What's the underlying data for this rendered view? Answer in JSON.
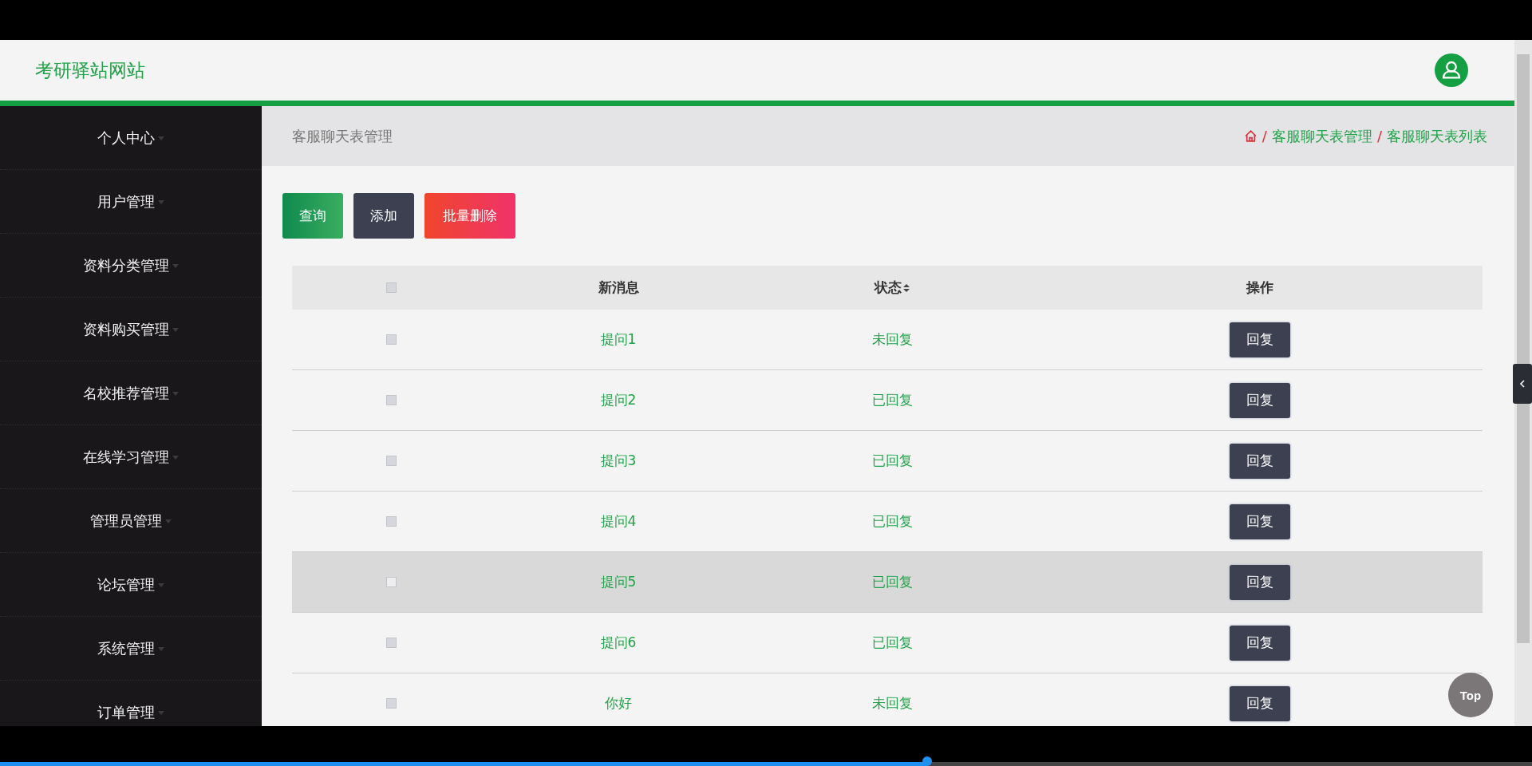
{
  "header": {
    "site_title": "考研驿站网站"
  },
  "sidebar": {
    "items": [
      {
        "label": "个人中心"
      },
      {
        "label": "用户管理"
      },
      {
        "label": "资料分类管理"
      },
      {
        "label": "资料购买管理"
      },
      {
        "label": "名校推荐管理"
      },
      {
        "label": "在线学习管理"
      },
      {
        "label": "管理员管理"
      },
      {
        "label": "论坛管理"
      },
      {
        "label": "系统管理"
      },
      {
        "label": "订单管理"
      }
    ]
  },
  "page_title": "客服聊天表管理",
  "breadcrumb": [
    {
      "separator": "/",
      "label": "客服聊天表管理"
    },
    {
      "separator": "/",
      "label": "客服聊天表列表"
    }
  ],
  "toolbar": [
    {
      "label": "查询",
      "kind": "search"
    },
    {
      "label": "添加",
      "kind": "add"
    },
    {
      "label": "批量删除",
      "kind": "delete"
    }
  ],
  "table": {
    "columns": [
      {
        "label": "新消息",
        "sortable": false
      },
      {
        "label": "状态",
        "sortable": true
      },
      {
        "label": "操作",
        "sortable": false
      }
    ],
    "header_checked": false,
    "rows": [
      {
        "message": "提问1",
        "status": "未回复",
        "action": "回复",
        "checked": false,
        "highlighted": false
      },
      {
        "message": "提问2",
        "status": "已回复",
        "action": "回复",
        "checked": false,
        "highlighted": false
      },
      {
        "message": "提问3",
        "status": "已回复",
        "action": "回复",
        "checked": false,
        "highlighted": false
      },
      {
        "message": "提问4",
        "status": "已回复",
        "action": "回复",
        "checked": false,
        "highlighted": false
      },
      {
        "message": "提问5",
        "status": "已回复",
        "action": "回复",
        "checked": false,
        "highlighted": true
      },
      {
        "message": "提问6",
        "status": "已回复",
        "action": "回复",
        "checked": false,
        "highlighted": false
      },
      {
        "message": "你好",
        "status": "未回复",
        "action": "回复",
        "checked": false,
        "highlighted": false
      }
    ]
  },
  "back_to_top": "Top",
  "player": {
    "progress": {
      "level": 0.605
    }
  }
}
